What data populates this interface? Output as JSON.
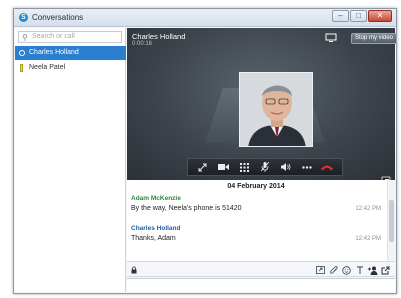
{
  "window": {
    "title": "Conversations",
    "accent": "#2a7fd0"
  },
  "sidebar": {
    "search_placeholder": "Search or call",
    "contacts": [
      {
        "name": "Charles Holland",
        "active": true
      },
      {
        "name": "Neela Patel",
        "active": false
      }
    ]
  },
  "call": {
    "caller": "Charles Holland",
    "duration": "0:00:16",
    "stop_video_label": "Stop my video"
  },
  "toolbar": {
    "buttons": [
      "expand-icon",
      "video-icon",
      "dialpad-icon",
      "mute-icon",
      "volume-icon",
      "more-icon",
      "hangup-icon"
    ],
    "hangup_color": "#e03030"
  },
  "conversation": {
    "date": "04 February 2014",
    "messages": [
      {
        "author": "Adam McKenzie",
        "text": "By the way, Neela's phone is 51420",
        "time": "12:42 PM",
        "author_color": "#2a8a3a"
      },
      {
        "author": "Charles Holland",
        "text": "Thanks, Adam",
        "time": "12:42 PM",
        "author_color": "#1f5fa8"
      }
    ]
  },
  "compose": {
    "icons": [
      "screenshare-icon",
      "attach-icon",
      "emoticon-icon",
      "font-icon",
      "add-person-icon",
      "popout-icon"
    ]
  }
}
